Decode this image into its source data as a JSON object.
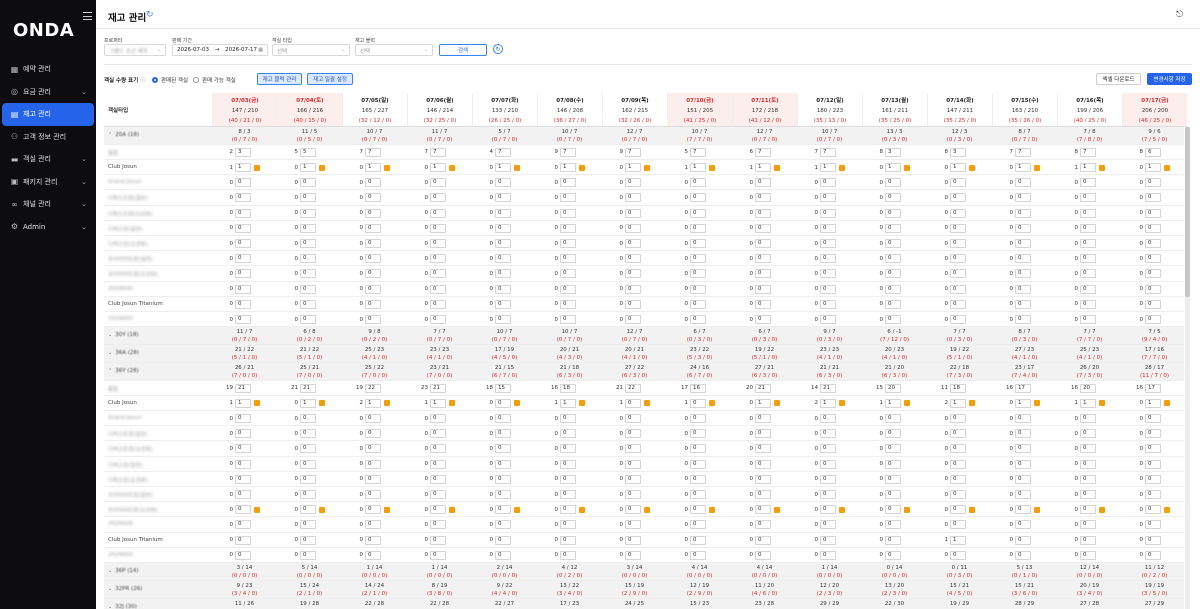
{
  "app": {
    "logo": "ONDA"
  },
  "sidebar": [
    {
      "key": "reserve",
      "label": "예약 관리",
      "icon": "calendar-icon",
      "chev": ""
    },
    {
      "key": "rate",
      "label": "요금 관리",
      "icon": "coin-icon",
      "chev": "⌄"
    },
    {
      "key": "stock",
      "label": "재고 관리",
      "icon": "grid-icon",
      "chev": "",
      "active": true
    },
    {
      "key": "customer",
      "label": "고객 정보 관리",
      "icon": "user-icon",
      "chev": ""
    },
    {
      "key": "room",
      "label": "객실 관리",
      "icon": "bed-icon",
      "chev": "⌄"
    },
    {
      "key": "package",
      "label": "패키지 관리",
      "icon": "package-icon",
      "chev": "⌄"
    },
    {
      "key": "channel",
      "label": "채널 관리",
      "icon": "link-icon",
      "chev": "⌄"
    },
    {
      "key": "admin",
      "label": "Admin",
      "icon": "gear-icon",
      "chev": "⌄"
    }
  ],
  "header": {
    "title": "재고 관리"
  },
  "filters": {
    "property_label": "프로퍼티",
    "property_value": "그랜드 조선 제주",
    "period_label": "판매 기간",
    "date_from": "2026-07-03",
    "date_sep": "→",
    "date_to": "2026-07-17",
    "roomtype_label": "객실 타입",
    "roomtype_placeholder": "선택",
    "block_label": "재고 블럭",
    "block_placeholder": "선택",
    "search_label": "검색"
  },
  "toolbar": {
    "qty_label": "객실 수량 표기",
    "radio_sold": "판매된 객실",
    "radio_available": "판매 가능 객실",
    "block_manage": "재고 블럭 관리",
    "bulk_set": "재고 일괄 설정",
    "excel": "엑셀 다운로드",
    "save": "변경사항 저장"
  },
  "grid_header_label": "객실타입",
  "dates": [
    {
      "date": "07/03(금)",
      "total": "147 / 210",
      "sub": "(40 / 21 / 0)",
      "holiday": true
    },
    {
      "date": "07/04(토)",
      "total": "166 / 216",
      "sub": "(40 / 15 / 0)",
      "holiday": true
    },
    {
      "date": "07/05(일)",
      "total": "165 / 227",
      "sub": "(32 / 12 / 0)",
      "holiday": false
    },
    {
      "date": "07/06(월)",
      "total": "146 / 214",
      "sub": "(32 / 25 / 0)",
      "holiday": false
    },
    {
      "date": "07/07(화)",
      "total": "133 / 210",
      "sub": "(26 / 25 / 0)",
      "holiday": false
    },
    {
      "date": "07/08(수)",
      "total": "146 / 208",
      "sub": "(36 / 27 / 0)",
      "holiday": false
    },
    {
      "date": "07/09(목)",
      "total": "162 / 215",
      "sub": "(32 / 26 / 0)",
      "holiday": false
    },
    {
      "date": "07/10(금)",
      "total": "151 / 205",
      "sub": "(41 / 25 / 0)",
      "holiday": true
    },
    {
      "date": "07/11(토)",
      "total": "172 / 218",
      "sub": "(41 / 12 / 0)",
      "holiday": true
    },
    {
      "date": "07/12(일)",
      "total": "180 / 223",
      "sub": "(35 / 13 / 0)",
      "holiday": false
    },
    {
      "date": "07/13(월)",
      "total": "161 / 211",
      "sub": "(35 / 25 / 0)",
      "holiday": false
    },
    {
      "date": "07/14(화)",
      "total": "147 / 211",
      "sub": "(35 / 25 / 0)",
      "holiday": false
    },
    {
      "date": "07/15(수)",
      "total": "163 / 210",
      "sub": "(35 / 26 / 0)",
      "holiday": false
    },
    {
      "date": "07/16(목)",
      "total": "199 / 206",
      "sub": "(40 / 25 / 0)",
      "holiday": false
    },
    {
      "date": "07/17(금)",
      "total": "206 / 200",
      "sub": "(46 / 25 / 0)",
      "holiday": true
    }
  ],
  "rows": [
    {
      "type": "group",
      "label": "20A (18)",
      "caret": "⌃",
      "lines": [
        [
          "8 / 3",
          "(0 / 7 / 0)"
        ],
        [
          "11 / 5",
          "(0 / 5 / 0)"
        ],
        [
          "10 / 7",
          "(0 / 7 / 0)"
        ],
        [
          "11 / 7",
          "(0 / 7 / 0)"
        ],
        [
          "5 / 7",
          "(0 / 7 / 0)"
        ],
        [
          "10 / 7",
          "(0 / 7 / 0)"
        ],
        [
          "12 / 7",
          "(0 / 7 / 0)"
        ],
        [
          "10 / 7",
          "(7 / 7 / 0)"
        ],
        [
          "12 / 7",
          "(0 / 7 / 0)"
        ],
        [
          "10 / 7",
          "(0 / 7 / 0)"
        ],
        [
          "13 / 3",
          "(0 / 3 / 0)"
        ],
        [
          "12 / 3",
          "(0 / 3 / 0)"
        ],
        [
          "8 / 7",
          "(0 / 7 / 0)"
        ],
        [
          "7 / 8",
          "(7 / 8 / 0)"
        ],
        [
          "9 / 6",
          "(7 / 5 / 0)"
        ]
      ]
    },
    {
      "type": "room",
      "label": "통합",
      "blur": true,
      "cb": false,
      "vals": [
        [
          "2",
          "3"
        ],
        [
          "5",
          "5"
        ],
        [
          "7",
          "7"
        ],
        [
          "7",
          "7"
        ],
        [
          "4",
          "7"
        ],
        [
          "9",
          "7"
        ],
        [
          "9",
          "7"
        ],
        [
          "5",
          "7"
        ],
        [
          "6",
          "7"
        ],
        [
          "7",
          "7"
        ],
        [
          "8",
          "3"
        ],
        [
          "8",
          "3"
        ],
        [
          "7",
          "7"
        ],
        [
          "8",
          "7"
        ],
        [
          "8",
          "6"
        ]
      ]
    },
    {
      "type": "room",
      "label": "Club Josun",
      "blur": false,
      "cb": true,
      "vals": [
        [
          "1",
          "1"
        ],
        [
          "0",
          "1"
        ],
        [
          "0",
          "1"
        ],
        [
          "0",
          "1"
        ],
        [
          "0",
          "1"
        ],
        [
          "0",
          "1"
        ],
        [
          "0",
          "1"
        ],
        [
          "1",
          "1"
        ],
        [
          "1",
          "1"
        ],
        [
          "1",
          "1"
        ],
        [
          "0",
          "1"
        ],
        [
          "0",
          "1"
        ],
        [
          "0",
          "1"
        ],
        [
          "1",
          "1"
        ],
        [
          "0",
          "1"
        ]
      ]
    },
    {
      "type": "room",
      "label": "Grand Josun",
      "blur": true,
      "cb": false,
      "vals": "zero"
    },
    {
      "type": "room",
      "label": "디럭스트윈(일반)",
      "blur": true,
      "cb": false,
      "vals": "zero"
    },
    {
      "type": "room",
      "label": "디럭스트윈(오션뷰)",
      "blur": true,
      "cb": false,
      "vals": "zero"
    },
    {
      "type": "room",
      "label": "디럭스킹(일반)",
      "blur": true,
      "cb": false,
      "vals": "zero"
    },
    {
      "type": "room",
      "label": "디럭스킹(오션뷰)",
      "blur": true,
      "cb": false,
      "vals": "zero"
    },
    {
      "type": "room",
      "label": "프리미어트윈(일반)",
      "blur": true,
      "cb": false,
      "vals": "zero"
    },
    {
      "type": "room",
      "label": "프리미어트윈(오션뷰)",
      "blur": true,
      "cb": false,
      "vals": "zero"
    },
    {
      "type": "room",
      "label": "2024A30",
      "blur": true,
      "cb": false,
      "vals": "zero"
    },
    {
      "type": "room",
      "label": "Club Josun Titanium",
      "blur": false,
      "cb": false,
      "vals": "zero"
    },
    {
      "type": "room",
      "label": "2024A50",
      "blur": true,
      "cb": false,
      "vals": "zero"
    },
    {
      "type": "group",
      "label": "30Y (18)",
      "caret": "⌄",
      "lines": [
        [
          "11 / 7",
          "(0 / 7 / 0)"
        ],
        [
          "6 / 8",
          "(0 / 2 / 0)"
        ],
        [
          "9 / 8",
          "(0 / 2 / 0)"
        ],
        [
          "7 / 7",
          "(0 / 7 / 0)"
        ],
        [
          "10 / 7",
          "(0 / 7 / 0)"
        ],
        [
          "10 / 7",
          "(0 / 7 / 0)"
        ],
        [
          "12 / 7",
          "(0 / 7 / 0)"
        ],
        [
          "6 / 7",
          "(0 / 3 / 0)"
        ],
        [
          "6 / 7",
          "(0 / 3 / 0)"
        ],
        [
          "9 / 7",
          "(0 / 3 / 0)"
        ],
        [
          "6 / -1",
          "(7 / 12 / 0)"
        ],
        [
          "7 / 7",
          "(0 / 3 / 0)"
        ],
        [
          "8 / 7",
          "(0 / 3 / 0)"
        ],
        [
          "7 / 7",
          "(7 / 7 / 0)"
        ],
        [
          "7 / 5",
          "(9 / 4 / 0)"
        ]
      ]
    },
    {
      "type": "group",
      "label": "36A (28)",
      "caret": "⌄",
      "lines": [
        [
          "21 / 22",
          "(5 / 1 / 0)"
        ],
        [
          "21 / 22",
          "(5 / 1 / 0)"
        ],
        [
          "25 / 23",
          "(4 / 1 / 0)"
        ],
        [
          "23 / 23",
          "(4 / 1 / 0)"
        ],
        [
          "17 / 19",
          "(4 / 5 / 0)"
        ],
        [
          "20 / 21",
          "(4 / 3 / 0)"
        ],
        [
          "20 / 21",
          "(4 / 1 / 0)"
        ],
        [
          "23 / 22",
          "(5 / 3 / 0)"
        ],
        [
          "19 / 22",
          "(5 / 1 / 0)"
        ],
        [
          "23 / 23",
          "(4 / 1 / 0)"
        ],
        [
          "20 / 23",
          "(4 / 1 / 0)"
        ],
        [
          "19 / 22",
          "(5 / 1 / 0)"
        ],
        [
          "27 / 23",
          "(4 / 1 / 0)"
        ],
        [
          "25 / 23",
          "(4 / 1 / 0)"
        ],
        [
          "17 / 16",
          "(7 / 7 / 0)"
        ]
      ]
    },
    {
      "type": "group",
      "label": "36Y (28)",
      "caret": "⌃",
      "lines": [
        [
          "26 / 21",
          "(7 / 0 / 0)"
        ],
        [
          "25 / 21",
          "(7 / 0 / 0)"
        ],
        [
          "25 / 22",
          "(7 / 0 / 0)"
        ],
        [
          "23 / 21",
          "(7 / 0 / 0)"
        ],
        [
          "21 / 15",
          "(6 / 7 / 0)"
        ],
        [
          "21 / 18",
          "(6 / 3 / 0)"
        ],
        [
          "27 / 22",
          "(6 / 3 / 0)"
        ],
        [
          "24 / 16",
          "(6 / 7 / 0)"
        ],
        [
          "27 / 21",
          "(6 / 3 / 0)"
        ],
        [
          "21 / 21",
          "(6 / 3 / 0)"
        ],
        [
          "21 / 20",
          "(6 / 3 / 0)"
        ],
        [
          "22 / 18",
          "(7 / 3 / 0)"
        ],
        [
          "23 / 17",
          "(7 / 4 / 0)"
        ],
        [
          "26 / 20",
          "(7 / 3 / 0)"
        ],
        [
          "28 / 17",
          "(11 / 7 / 0)"
        ]
      ]
    },
    {
      "type": "room",
      "label": "통합",
      "blur": true,
      "cb": false,
      "vals": [
        [
          "19",
          "21"
        ],
        [
          "21",
          "21"
        ],
        [
          "19",
          "22"
        ],
        [
          "23",
          "21"
        ],
        [
          "18",
          "15"
        ],
        [
          "16",
          "18"
        ],
        [
          "21",
          "22"
        ],
        [
          "17",
          "16"
        ],
        [
          "20",
          "21"
        ],
        [
          "14",
          "21"
        ],
        [
          "15",
          "20"
        ],
        [
          "11",
          "18"
        ],
        [
          "16",
          "17"
        ],
        [
          "16",
          "20"
        ],
        [
          "16",
          "17"
        ]
      ]
    },
    {
      "type": "room",
      "label": "Club Josun",
      "blur": false,
      "cb": true,
      "vals": [
        [
          "1",
          "1"
        ],
        [
          "0",
          "1"
        ],
        [
          "2",
          "1"
        ],
        [
          "1",
          "1"
        ],
        [
          "0",
          "0"
        ],
        [
          "1",
          "1"
        ],
        [
          "1",
          "0"
        ],
        [
          "1",
          "0"
        ],
        [
          "0",
          "1"
        ],
        [
          "2",
          "1"
        ],
        [
          "1",
          "1"
        ],
        [
          "2",
          "1"
        ],
        [
          "0",
          "1"
        ],
        [
          "1",
          "1"
        ],
        [
          "0",
          "1"
        ]
      ]
    },
    {
      "type": "room",
      "label": "Grand Josun",
      "blur": true,
      "cb": false,
      "vals": "zero"
    },
    {
      "type": "room",
      "label": "디럭스트윈(일반)",
      "blur": true,
      "cb": false,
      "vals": "zero"
    },
    {
      "type": "room",
      "label": "디럭스트윈(오션뷰)",
      "blur": true,
      "cb": false,
      "vals": "zero"
    },
    {
      "type": "room",
      "label": "디럭스킹(일반)",
      "blur": true,
      "cb": false,
      "vals": "zero"
    },
    {
      "type": "room",
      "label": "디럭스킹(오션뷰)",
      "blur": true,
      "cb": false,
      "vals": "zero"
    },
    {
      "type": "room",
      "label": "프리미어트윈(일반)",
      "blur": true,
      "cb": false,
      "vals": "zero"
    },
    {
      "type": "room",
      "label": "프리미어트윈(오션뷰)",
      "blur": true,
      "cb": true,
      "vals": "zero"
    },
    {
      "type": "room",
      "label": "2024A30",
      "blur": true,
      "cb": false,
      "vals": "zero"
    },
    {
      "type": "room",
      "label": "Club Josun Titanium",
      "blur": false,
      "cb": false,
      "vals": [
        [
          "0",
          "0"
        ],
        [
          "0",
          "0"
        ],
        [
          "0",
          "0"
        ],
        [
          "0",
          "0"
        ],
        [
          "0",
          "0"
        ],
        [
          "0",
          "0"
        ],
        [
          "0",
          "0"
        ],
        [
          "0",
          "0"
        ],
        [
          "0",
          "0"
        ],
        [
          "0",
          "0"
        ],
        [
          "0",
          "0"
        ],
        [
          "1",
          "1"
        ],
        [
          "0",
          "0"
        ],
        [
          "0",
          "0"
        ],
        [
          "0",
          "0"
        ]
      ]
    },
    {
      "type": "room",
      "label": "2024A50",
      "blur": true,
      "cb": false,
      "vals": "zero"
    },
    {
      "type": "group",
      "label": "36P (14)",
      "caret": "⌄",
      "lines": [
        [
          "3 / 14",
          "(0 / 0 / 0)"
        ],
        [
          "5 / 14",
          "(0 / 0 / 0)"
        ],
        [
          "1 / 14",
          "(0 / 0 / 0)"
        ],
        [
          "1 / 14",
          "(0 / 0 / 0)"
        ],
        [
          "2 / 14",
          "(0 / 0 / 0)"
        ],
        [
          "4 / 12",
          "(0 / 2 / 0)"
        ],
        [
          "3 / 14",
          "(0 / 0 / 0)"
        ],
        [
          "4 / 14",
          "(0 / 0 / 0)"
        ],
        [
          "4 / 14",
          "(0 / 0 / 0)"
        ],
        [
          "1 / 14",
          "(0 / 0 / 0)"
        ],
        [
          "0 / 14",
          "(0 / 0 / 0)"
        ],
        [
          "0 / 11",
          "(0 / 3 / 0)"
        ],
        [
          "5 / 13",
          "(0 / 1 / 0)"
        ],
        [
          "12 / 14",
          "(0 / 0 / 0)"
        ],
        [
          "11 / 12",
          "(0 / 2 / 0)"
        ]
      ]
    },
    {
      "type": "group",
      "label": "32PR (26)",
      "caret": "⌄",
      "lines": [
        [
          "9 / 23",
          "(3 / 4 / 0)"
        ],
        [
          "15 / 24",
          "(2 / 1 / 0)"
        ],
        [
          "14 / 24",
          "(2 / 1 / 0)"
        ],
        [
          "8 / 19",
          "(3 / 8 / 0)"
        ],
        [
          "9 / 22",
          "(4 / 4 / 0)"
        ],
        [
          "13 / 22",
          "(3 / 4 / 0)"
        ],
        [
          "15 / 19",
          "(2 / 9 / 0)"
        ],
        [
          "12 / 19",
          "(2 / 9 / 0)"
        ],
        [
          "11 / 20",
          "(4 / 6 / 0)"
        ],
        [
          "12 / 20",
          "(2 / 3 / 0)"
        ],
        [
          "13 / 20",
          "(2 / 3 / 0)"
        ],
        [
          "15 / 21",
          "(4 / 5 / 0)"
        ],
        [
          "15 / 21",
          "(3 / 6 / 0)"
        ],
        [
          "20 / 19",
          "(3 / 4 / 0)"
        ],
        [
          "19 / 19",
          "(3 / 5 / 0)"
        ]
      ]
    },
    {
      "type": "group",
      "label": "32J (30)",
      "caret": "⌄",
      "lines": [
        [
          "11 / 26",
          ""
        ],
        [
          "19 / 28",
          ""
        ],
        [
          "22 / 28",
          ""
        ],
        [
          "22 / 28",
          ""
        ],
        [
          "22 / 27",
          ""
        ],
        [
          "17 / 23",
          ""
        ],
        [
          "24 / 25",
          ""
        ],
        [
          "15 / 23",
          ""
        ],
        [
          "23 / 28",
          ""
        ],
        [
          "29 / 29",
          ""
        ],
        [
          "22 / 30",
          ""
        ],
        [
          "19 / 29",
          ""
        ],
        [
          "28 / 29",
          ""
        ],
        [
          "27 / 28",
          ""
        ],
        [
          "27 / 29",
          ""
        ]
      ]
    }
  ]
}
